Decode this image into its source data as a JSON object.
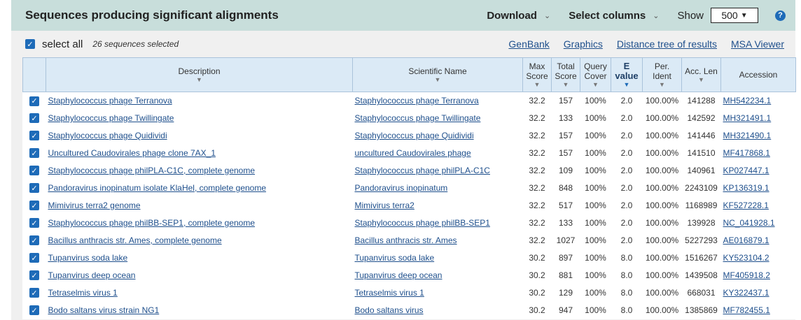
{
  "header": {
    "title": "Sequences producing significant alignments",
    "download_label": "Download",
    "select_columns_label": "Select columns",
    "show_label": "Show",
    "show_value": "500",
    "help_glyph": "?"
  },
  "toolbar": {
    "select_all_label": "select all",
    "selected_count": "26 sequences selected",
    "links": [
      "GenBank",
      "Graphics",
      "Distance tree of results",
      "MSA Viewer"
    ]
  },
  "columns": {
    "description": "Description",
    "scientific_name": "Scientific Name",
    "max_score_1": "Max",
    "max_score_2": "Score",
    "total_score_1": "Total",
    "total_score_2": "Score",
    "query_cover_1": "Query",
    "query_cover_2": "Cover",
    "e_value_1": "E",
    "e_value_2": "value",
    "per_ident_1": "Per.",
    "per_ident_2": "Ident",
    "acc_len": "Acc. Len",
    "accession": "Accession"
  },
  "rows": [
    {
      "description": "Staphylococcus phage Terranova",
      "scientific_name": "Staphylococcus phage Terranova",
      "max_score": "32.2",
      "total_score": "157",
      "query_cover": "100%",
      "e_value": "2.0",
      "per_ident": "100.00%",
      "acc_len": "141288",
      "accession": "MH542234.1"
    },
    {
      "description": "Staphylococcus phage Twillingate",
      "scientific_name": "Staphylococcus phage Twillingate",
      "max_score": "32.2",
      "total_score": "133",
      "query_cover": "100%",
      "e_value": "2.0",
      "per_ident": "100.00%",
      "acc_len": "142592",
      "accession": "MH321491.1"
    },
    {
      "description": "Staphylococcus phage Quidividi",
      "scientific_name": "Staphylococcus phage Quidividi",
      "max_score": "32.2",
      "total_score": "157",
      "query_cover": "100%",
      "e_value": "2.0",
      "per_ident": "100.00%",
      "acc_len": "141446",
      "accession": "MH321490.1"
    },
    {
      "description": "Uncultured Caudovirales phage clone 7AX_1",
      "scientific_name": "uncultured Caudovirales phage",
      "max_score": "32.2",
      "total_score": "157",
      "query_cover": "100%",
      "e_value": "2.0",
      "per_ident": "100.00%",
      "acc_len": "141510",
      "accession": "MF417868.1"
    },
    {
      "description": "Staphylococcus phage philPLA-C1C, complete genome",
      "scientific_name": "Staphylococcus phage philPLA-C1C",
      "max_score": "32.2",
      "total_score": "109",
      "query_cover": "100%",
      "e_value": "2.0",
      "per_ident": "100.00%",
      "acc_len": "140961",
      "accession": "KP027447.1"
    },
    {
      "description": "Pandoravirus inopinatum isolate KlaHel, complete genome",
      "scientific_name": "Pandoravirus inopinatum",
      "max_score": "32.2",
      "total_score": "848",
      "query_cover": "100%",
      "e_value": "2.0",
      "per_ident": "100.00%",
      "acc_len": "2243109",
      "accession": "KP136319.1"
    },
    {
      "description": "Mimivirus terra2 genome",
      "scientific_name": "Mimivirus terra2",
      "max_score": "32.2",
      "total_score": "517",
      "query_cover": "100%",
      "e_value": "2.0",
      "per_ident": "100.00%",
      "acc_len": "1168989",
      "accession": "KF527228.1"
    },
    {
      "description": "Staphylococcus phage philBB-SEP1, complete genome",
      "scientific_name": "Staphylococcus phage philBB-SEP1",
      "max_score": "32.2",
      "total_score": "133",
      "query_cover": "100%",
      "e_value": "2.0",
      "per_ident": "100.00%",
      "acc_len": "139928",
      "accession": "NC_041928.1"
    },
    {
      "description": "Bacillus anthracis str. Ames, complete genome",
      "scientific_name": "Bacillus anthracis str. Ames",
      "max_score": "32.2",
      "total_score": "1027",
      "query_cover": "100%",
      "e_value": "2.0",
      "per_ident": "100.00%",
      "acc_len": "5227293",
      "accession": "AE016879.1"
    },
    {
      "description": "Tupanvirus soda lake",
      "scientific_name": "Tupanvirus soda lake",
      "max_score": "30.2",
      "total_score": "897",
      "query_cover": "100%",
      "e_value": "8.0",
      "per_ident": "100.00%",
      "acc_len": "1516267",
      "accession": "KY523104.2"
    },
    {
      "description": "Tupanvirus deep ocean",
      "scientific_name": "Tupanvirus deep ocean",
      "max_score": "30.2",
      "total_score": "881",
      "query_cover": "100%",
      "e_value": "8.0",
      "per_ident": "100.00%",
      "acc_len": "1439508",
      "accession": "MF405918.2"
    },
    {
      "description": "Tetraselmis virus 1",
      "scientific_name": "Tetraselmis virus 1",
      "max_score": "30.2",
      "total_score": "129",
      "query_cover": "100%",
      "e_value": "8.0",
      "per_ident": "100.00%",
      "acc_len": "668031",
      "accession": "KY322437.1"
    },
    {
      "description": "Bodo saltans virus strain NG1",
      "scientific_name": "Bodo saltans virus",
      "max_score": "30.2",
      "total_score": "947",
      "query_cover": "100%",
      "e_value": "8.0",
      "per_ident": "100.00%",
      "acc_len": "1385869",
      "accession": "MF782455.1"
    }
  ]
}
